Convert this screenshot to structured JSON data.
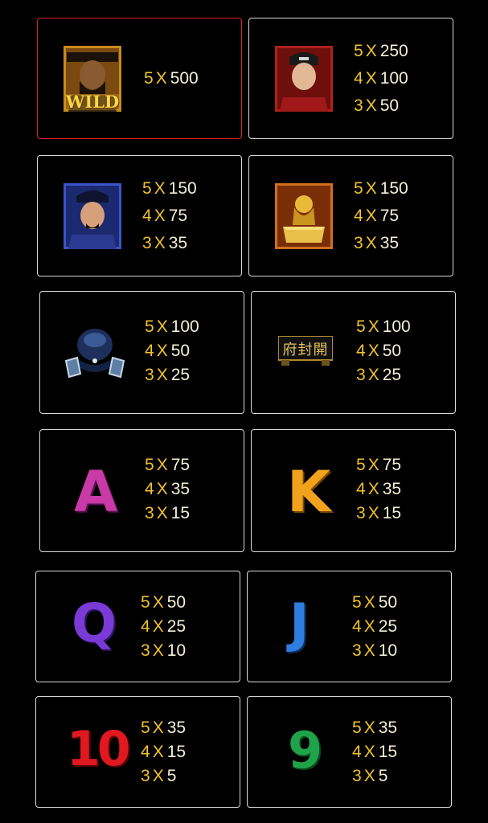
{
  "multiplier_sign": "X",
  "colors": {
    "payout_count": "#f2c32c",
    "payout_value": "#f5f0d8",
    "card_border": "#d9d9d9",
    "selected_border": "#e0202a",
    "background": "#000000"
  },
  "symbols": [
    {
      "id": "wild-judge",
      "icon": "judge-wild-icon",
      "wild_label": "WILD",
      "selected": true,
      "payouts": [
        {
          "count": "5",
          "value": "500"
        }
      ]
    },
    {
      "id": "red-official",
      "icon": "red-official-portrait-icon",
      "payouts": [
        {
          "count": "5",
          "value": "250"
        },
        {
          "count": "4",
          "value": "100"
        },
        {
          "count": "3",
          "value": "50"
        }
      ]
    },
    {
      "id": "blue-official",
      "icon": "blue-official-portrait-icon",
      "payouts": [
        {
          "count": "5",
          "value": "150"
        },
        {
          "count": "4",
          "value": "75"
        },
        {
          "count": "3",
          "value": "35"
        }
      ]
    },
    {
      "id": "golden-seal",
      "icon": "golden-seal-icon",
      "payouts": [
        {
          "count": "5",
          "value": "150"
        },
        {
          "count": "4",
          "value": "75"
        },
        {
          "count": "3",
          "value": "35"
        }
      ]
    },
    {
      "id": "official-hat",
      "icon": "official-hat-icon",
      "payouts": [
        {
          "count": "5",
          "value": "100"
        },
        {
          "count": "4",
          "value": "50"
        },
        {
          "count": "3",
          "value": "25"
        }
      ]
    },
    {
      "id": "kaifeng-plaque",
      "icon": "kaifeng-plaque-icon",
      "plaque_text": "府封開",
      "payouts": [
        {
          "count": "5",
          "value": "100"
        },
        {
          "count": "4",
          "value": "50"
        },
        {
          "count": "3",
          "value": "25"
        }
      ]
    },
    {
      "id": "letter-a",
      "icon": "letter-a-icon",
      "glyph": "A",
      "payouts": [
        {
          "count": "5",
          "value": "75"
        },
        {
          "count": "4",
          "value": "35"
        },
        {
          "count": "3",
          "value": "15"
        }
      ]
    },
    {
      "id": "letter-k",
      "icon": "letter-k-icon",
      "glyph": "K",
      "payouts": [
        {
          "count": "5",
          "value": "75"
        },
        {
          "count": "4",
          "value": "35"
        },
        {
          "count": "3",
          "value": "15"
        }
      ]
    },
    {
      "id": "letter-q",
      "icon": "letter-q-icon",
      "glyph": "Q",
      "payouts": [
        {
          "count": "5",
          "value": "50"
        },
        {
          "count": "4",
          "value": "25"
        },
        {
          "count": "3",
          "value": "10"
        }
      ]
    },
    {
      "id": "letter-j",
      "icon": "letter-j-icon",
      "glyph": "J",
      "payouts": [
        {
          "count": "5",
          "value": "50"
        },
        {
          "count": "4",
          "value": "25"
        },
        {
          "count": "3",
          "value": "10"
        }
      ]
    },
    {
      "id": "number-10",
      "icon": "number-10-icon",
      "glyph": "10",
      "payouts": [
        {
          "count": "5",
          "value": "35"
        },
        {
          "count": "4",
          "value": "15"
        },
        {
          "count": "3",
          "value": "5"
        }
      ]
    },
    {
      "id": "number-9",
      "icon": "number-9-icon",
      "glyph": "9",
      "payouts": [
        {
          "count": "5",
          "value": "35"
        },
        {
          "count": "4",
          "value": "15"
        },
        {
          "count": "3",
          "value": "5"
        }
      ]
    }
  ]
}
